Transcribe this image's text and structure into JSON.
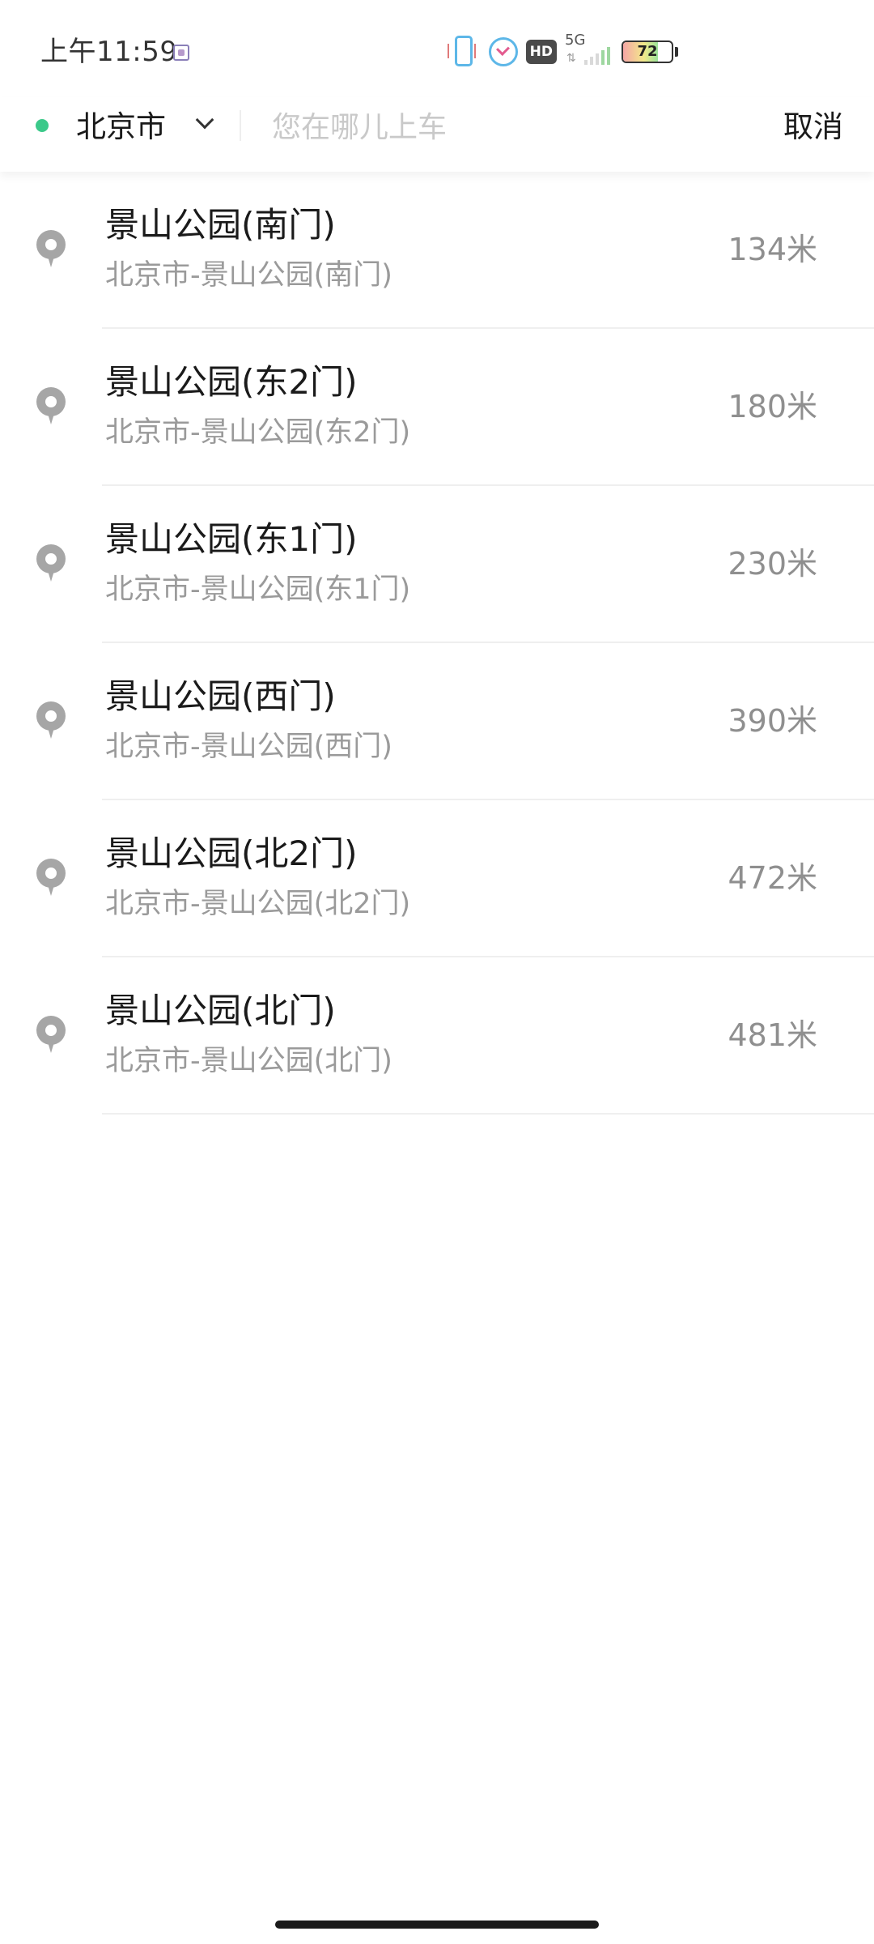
{
  "status_bar": {
    "time": "上午11:59",
    "network": "5G",
    "hd_badge": "HD",
    "battery_level": "72"
  },
  "search": {
    "city": "北京市",
    "placeholder": "您在哪儿上车",
    "value": "",
    "cancel_label": "取消"
  },
  "results": [
    {
      "title": "景山公园(南门)",
      "subtitle": "北京市-景山公园(南门)",
      "distance": "134米"
    },
    {
      "title": "景山公园(东2门)",
      "subtitle": "北京市-景山公园(东2门)",
      "distance": "180米"
    },
    {
      "title": "景山公园(东1门)",
      "subtitle": "北京市-景山公园(东1门)",
      "distance": "230米"
    },
    {
      "title": "景山公园(西门)",
      "subtitle": "北京市-景山公园(西门)",
      "distance": "390米"
    },
    {
      "title": "景山公园(北2门)",
      "subtitle": "北京市-景山公园(北2门)",
      "distance": "472米"
    },
    {
      "title": "景山公园(北门)",
      "subtitle": "北京市-景山公园(北门)",
      "distance": "481米"
    }
  ],
  "colors": {
    "accent_dot": "#3cc98a",
    "pin": "#a6a6a6",
    "secondary_text": "#9a9a9a"
  },
  "icons": {
    "location_dot": "location-dot-icon",
    "city_dropdown": "chevron-down-icon",
    "result_pin": "map-pin-icon"
  }
}
